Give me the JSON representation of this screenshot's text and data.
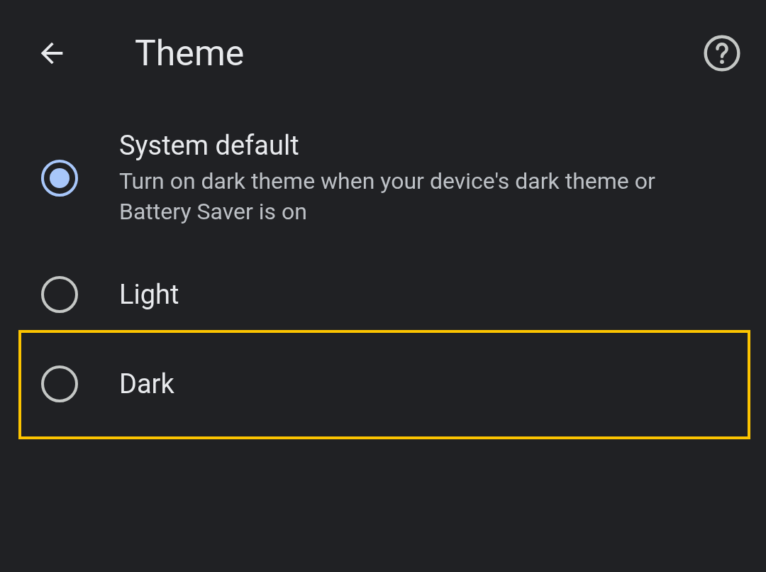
{
  "header": {
    "title": "Theme"
  },
  "options": [
    {
      "label": "System default",
      "description": "Turn on dark theme when your device's dark theme or Battery Saver is on",
      "selected": true,
      "highlighted": false
    },
    {
      "label": "Light",
      "selected": false,
      "highlighted": false
    },
    {
      "label": "Dark",
      "selected": false,
      "highlighted": true
    }
  ]
}
